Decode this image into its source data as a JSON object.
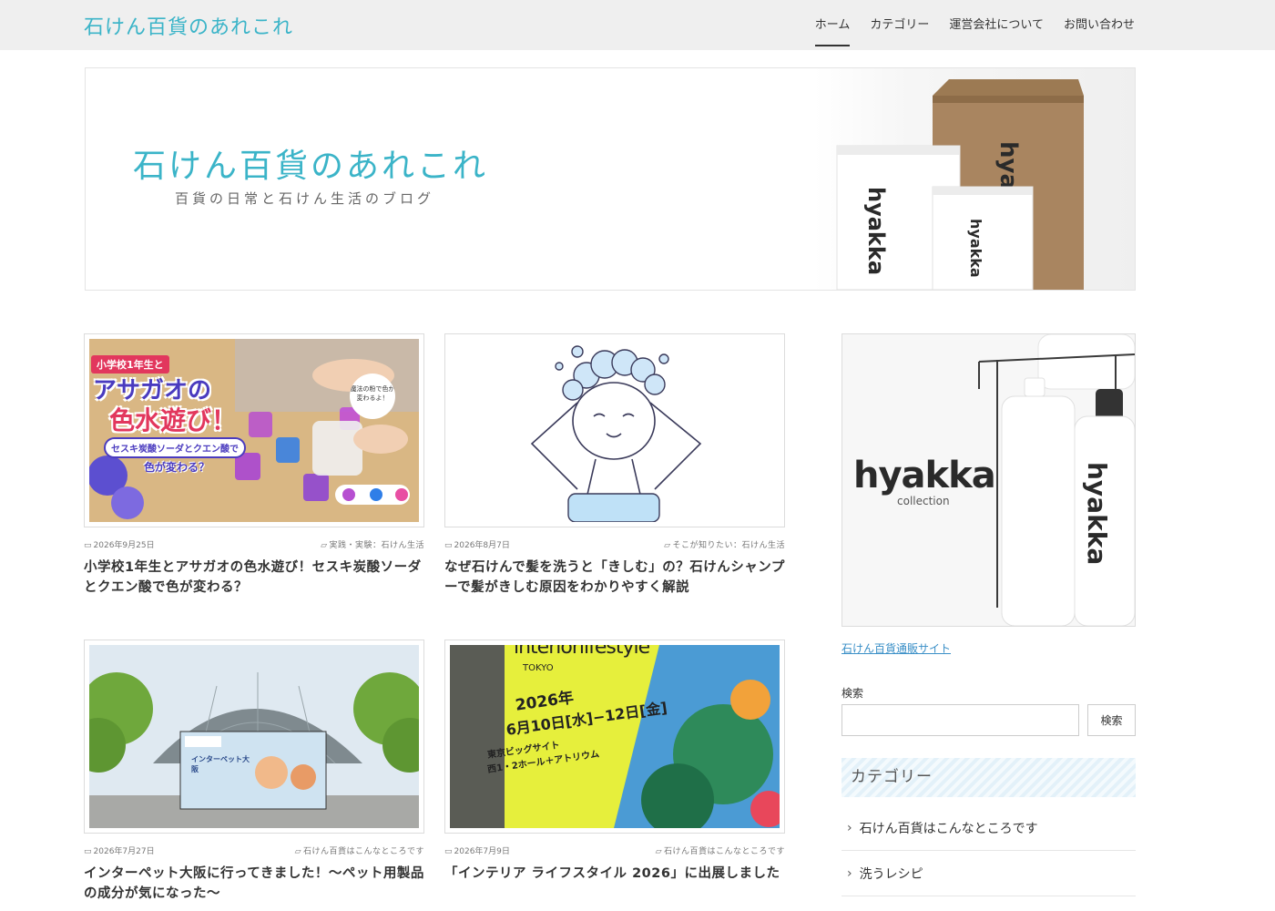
{
  "header": {
    "site_title": "石けん百貨のあれこれ",
    "nav": [
      {
        "label": "ホーム",
        "active": true
      },
      {
        "label": "カテゴリー",
        "active": false
      },
      {
        "label": "運営会社について",
        "active": false
      },
      {
        "label": "お問い合わせ",
        "active": false
      }
    ]
  },
  "hero": {
    "title": "石けん百貨のあれこれ",
    "subtitle": "百貨の日常と石けん生活のブログ",
    "bag_brand": "hyakka"
  },
  "posts": [
    {
      "date": "2026年9月25日",
      "category": "実践・実験：石けん生活",
      "title": "小学校1年生とアサガオの色水遊び！セスキ炭酸ソーダとクエン酸で色が変わる？",
      "thumb_text": {
        "tag": "小学校1年生と",
        "main1": "アサガオの",
        "main2": "色水遊び！",
        "sub1": "セスキ炭酸ソーダとクエン酸で",
        "sub2": "色が変わる？",
        "bubble": "魔法の粉で色が変わるよ！"
      }
    },
    {
      "date": "2026年8月7日",
      "category": "そこが知りたい：石けん生活",
      "title": "なぜ石けんで髪を洗うと「きしむ」の？石けんシャンプーで髪がきしむ原因をわかりやすく解説"
    },
    {
      "date": "2026年7月27日",
      "category": "石けん百貨はこんなところです",
      "title": "インターペット大阪に行ってきました！〜ペット用製品の成分が気になった〜",
      "thumb_text": {
        "board": "インターペット大阪"
      }
    },
    {
      "date": "2026年7月9日",
      "category": "石けん百貨はこんなところです",
      "title": "「インテリア ライフスタイル 2026」に出展しました",
      "thumb_text": {
        "brand": "interiorlifestyle",
        "city": "TOKYO",
        "year": "2026年",
        "dates": "6月10日[水]−12日[金]",
        "venue1": "東京ビッグサイト",
        "venue2": "西1・2ホール＋アトリウム"
      }
    }
  ],
  "sidebar": {
    "banner_brand": "hyakka",
    "banner_sub": "collection",
    "banner_link": "石けん百貨通販サイト",
    "search_label": "検索",
    "search_value": "",
    "search_button": "検索",
    "category_heading": "カテゴリー",
    "categories": [
      "石けん百貨はこんなところです",
      "洗うレシピ"
    ]
  },
  "colors": {
    "accent": "#3bb4c8",
    "header_bg": "#efefef",
    "link": "#3a8fc7"
  }
}
